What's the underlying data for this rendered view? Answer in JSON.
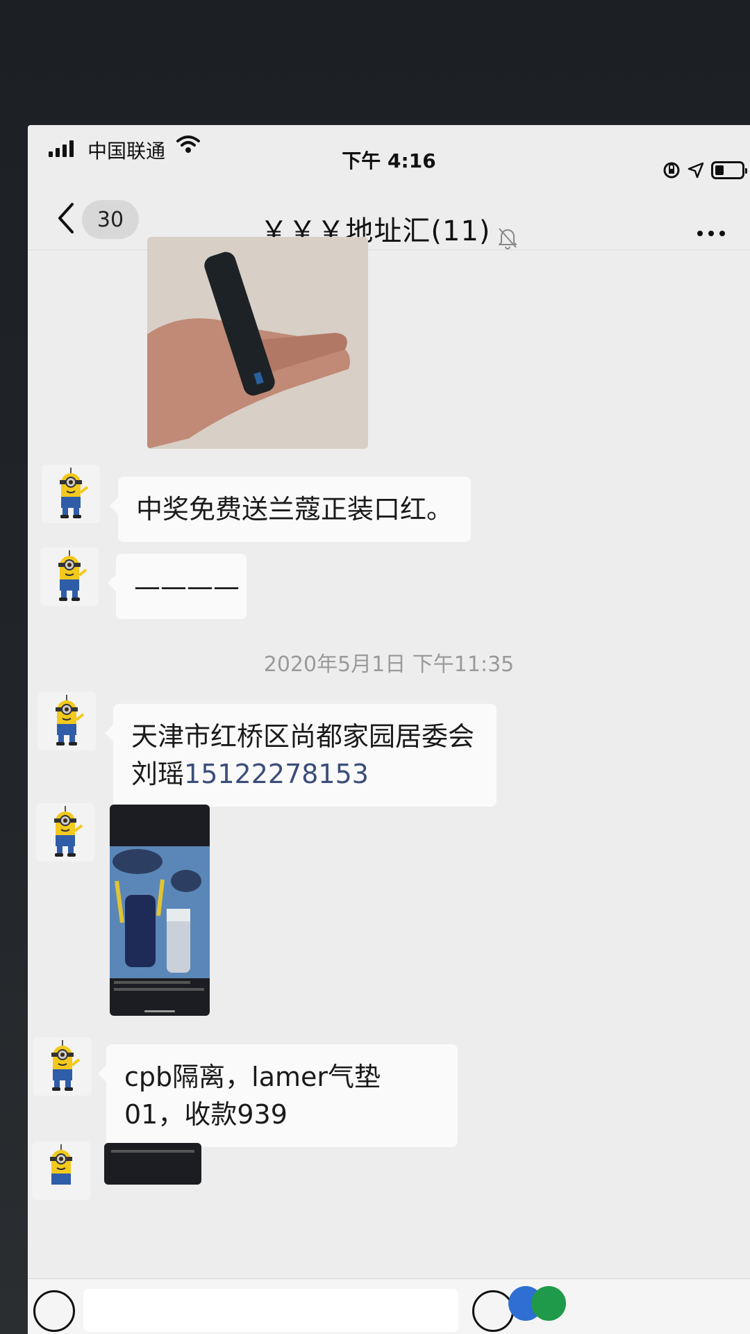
{
  "status_bar": {
    "carrier": "中国联通",
    "time": "下午 4:16"
  },
  "header": {
    "unread_count": "30",
    "title": "￥￥￥地址汇(11)"
  },
  "messages": [
    {
      "type": "image",
      "description": "photo"
    },
    {
      "type": "text",
      "text": "中奖免费送兰蔻正装口红。"
    },
    {
      "type": "text",
      "text": "————"
    },
    {
      "type": "timestamp",
      "text": "2020年5月1日 下午11:35"
    },
    {
      "type": "text",
      "text": "天津市红桥区尚都家园居委会  刘瑶",
      "phone": "15122278153"
    },
    {
      "type": "image",
      "description": "screenshot"
    },
    {
      "type": "text",
      "text": "cpb隔离，lamer气垫01，收款939"
    },
    {
      "type": "image",
      "description": "screenshot"
    }
  ],
  "colors": {
    "chat_background": "#ededed",
    "bubble": "#fafafa",
    "phone_link": "#3b4d7a",
    "timestamp": "#9a9a9a"
  },
  "icons": [
    "signal-icon",
    "wifi-icon",
    "orientation-lock-icon",
    "location-icon",
    "battery-icon",
    "back-icon",
    "mute-icon",
    "more-icon",
    "voice-icon",
    "emoji-icon"
  ]
}
